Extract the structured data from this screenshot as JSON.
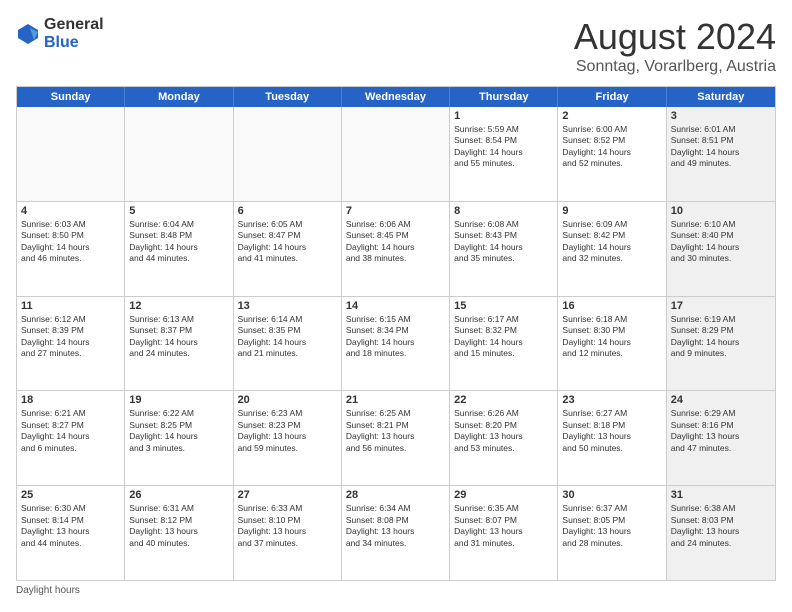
{
  "logo": {
    "general": "General",
    "blue": "Blue"
  },
  "title": "August 2024",
  "subtitle": "Sonntag, Vorarlberg, Austria",
  "headers": [
    "Sunday",
    "Monday",
    "Tuesday",
    "Wednesday",
    "Thursday",
    "Friday",
    "Saturday"
  ],
  "footer": "Daylight hours",
  "weeks": [
    [
      {
        "day": "",
        "info": "",
        "empty": true
      },
      {
        "day": "",
        "info": "",
        "empty": true
      },
      {
        "day": "",
        "info": "",
        "empty": true
      },
      {
        "day": "",
        "info": "",
        "empty": true
      },
      {
        "day": "1",
        "info": "Sunrise: 5:59 AM\nSunset: 8:54 PM\nDaylight: 14 hours\nand 55 minutes."
      },
      {
        "day": "2",
        "info": "Sunrise: 6:00 AM\nSunset: 8:52 PM\nDaylight: 14 hours\nand 52 minutes."
      },
      {
        "day": "3",
        "info": "Sunrise: 6:01 AM\nSunset: 8:51 PM\nDaylight: 14 hours\nand 49 minutes.",
        "shaded": true
      }
    ],
    [
      {
        "day": "4",
        "info": "Sunrise: 6:03 AM\nSunset: 8:50 PM\nDaylight: 14 hours\nand 46 minutes."
      },
      {
        "day": "5",
        "info": "Sunrise: 6:04 AM\nSunset: 8:48 PM\nDaylight: 14 hours\nand 44 minutes."
      },
      {
        "day": "6",
        "info": "Sunrise: 6:05 AM\nSunset: 8:47 PM\nDaylight: 14 hours\nand 41 minutes."
      },
      {
        "day": "7",
        "info": "Sunrise: 6:06 AM\nSunset: 8:45 PM\nDaylight: 14 hours\nand 38 minutes."
      },
      {
        "day": "8",
        "info": "Sunrise: 6:08 AM\nSunset: 8:43 PM\nDaylight: 14 hours\nand 35 minutes."
      },
      {
        "day": "9",
        "info": "Sunrise: 6:09 AM\nSunset: 8:42 PM\nDaylight: 14 hours\nand 32 minutes."
      },
      {
        "day": "10",
        "info": "Sunrise: 6:10 AM\nSunset: 8:40 PM\nDaylight: 14 hours\nand 30 minutes.",
        "shaded": true
      }
    ],
    [
      {
        "day": "11",
        "info": "Sunrise: 6:12 AM\nSunset: 8:39 PM\nDaylight: 14 hours\nand 27 minutes."
      },
      {
        "day": "12",
        "info": "Sunrise: 6:13 AM\nSunset: 8:37 PM\nDaylight: 14 hours\nand 24 minutes."
      },
      {
        "day": "13",
        "info": "Sunrise: 6:14 AM\nSunset: 8:35 PM\nDaylight: 14 hours\nand 21 minutes."
      },
      {
        "day": "14",
        "info": "Sunrise: 6:15 AM\nSunset: 8:34 PM\nDaylight: 14 hours\nand 18 minutes."
      },
      {
        "day": "15",
        "info": "Sunrise: 6:17 AM\nSunset: 8:32 PM\nDaylight: 14 hours\nand 15 minutes."
      },
      {
        "day": "16",
        "info": "Sunrise: 6:18 AM\nSunset: 8:30 PM\nDaylight: 14 hours\nand 12 minutes."
      },
      {
        "day": "17",
        "info": "Sunrise: 6:19 AM\nSunset: 8:29 PM\nDaylight: 14 hours\nand 9 minutes.",
        "shaded": true
      }
    ],
    [
      {
        "day": "18",
        "info": "Sunrise: 6:21 AM\nSunset: 8:27 PM\nDaylight: 14 hours\nand 6 minutes."
      },
      {
        "day": "19",
        "info": "Sunrise: 6:22 AM\nSunset: 8:25 PM\nDaylight: 14 hours\nand 3 minutes."
      },
      {
        "day": "20",
        "info": "Sunrise: 6:23 AM\nSunset: 8:23 PM\nDaylight: 13 hours\nand 59 minutes."
      },
      {
        "day": "21",
        "info": "Sunrise: 6:25 AM\nSunset: 8:21 PM\nDaylight: 13 hours\nand 56 minutes."
      },
      {
        "day": "22",
        "info": "Sunrise: 6:26 AM\nSunset: 8:20 PM\nDaylight: 13 hours\nand 53 minutes."
      },
      {
        "day": "23",
        "info": "Sunrise: 6:27 AM\nSunset: 8:18 PM\nDaylight: 13 hours\nand 50 minutes."
      },
      {
        "day": "24",
        "info": "Sunrise: 6:29 AM\nSunset: 8:16 PM\nDaylight: 13 hours\nand 47 minutes.",
        "shaded": true
      }
    ],
    [
      {
        "day": "25",
        "info": "Sunrise: 6:30 AM\nSunset: 8:14 PM\nDaylight: 13 hours\nand 44 minutes."
      },
      {
        "day": "26",
        "info": "Sunrise: 6:31 AM\nSunset: 8:12 PM\nDaylight: 13 hours\nand 40 minutes."
      },
      {
        "day": "27",
        "info": "Sunrise: 6:33 AM\nSunset: 8:10 PM\nDaylight: 13 hours\nand 37 minutes."
      },
      {
        "day": "28",
        "info": "Sunrise: 6:34 AM\nSunset: 8:08 PM\nDaylight: 13 hours\nand 34 minutes."
      },
      {
        "day": "29",
        "info": "Sunrise: 6:35 AM\nSunset: 8:07 PM\nDaylight: 13 hours\nand 31 minutes."
      },
      {
        "day": "30",
        "info": "Sunrise: 6:37 AM\nSunset: 8:05 PM\nDaylight: 13 hours\nand 28 minutes."
      },
      {
        "day": "31",
        "info": "Sunrise: 6:38 AM\nSunset: 8:03 PM\nDaylight: 13 hours\nand 24 minutes.",
        "shaded": true
      }
    ]
  ]
}
